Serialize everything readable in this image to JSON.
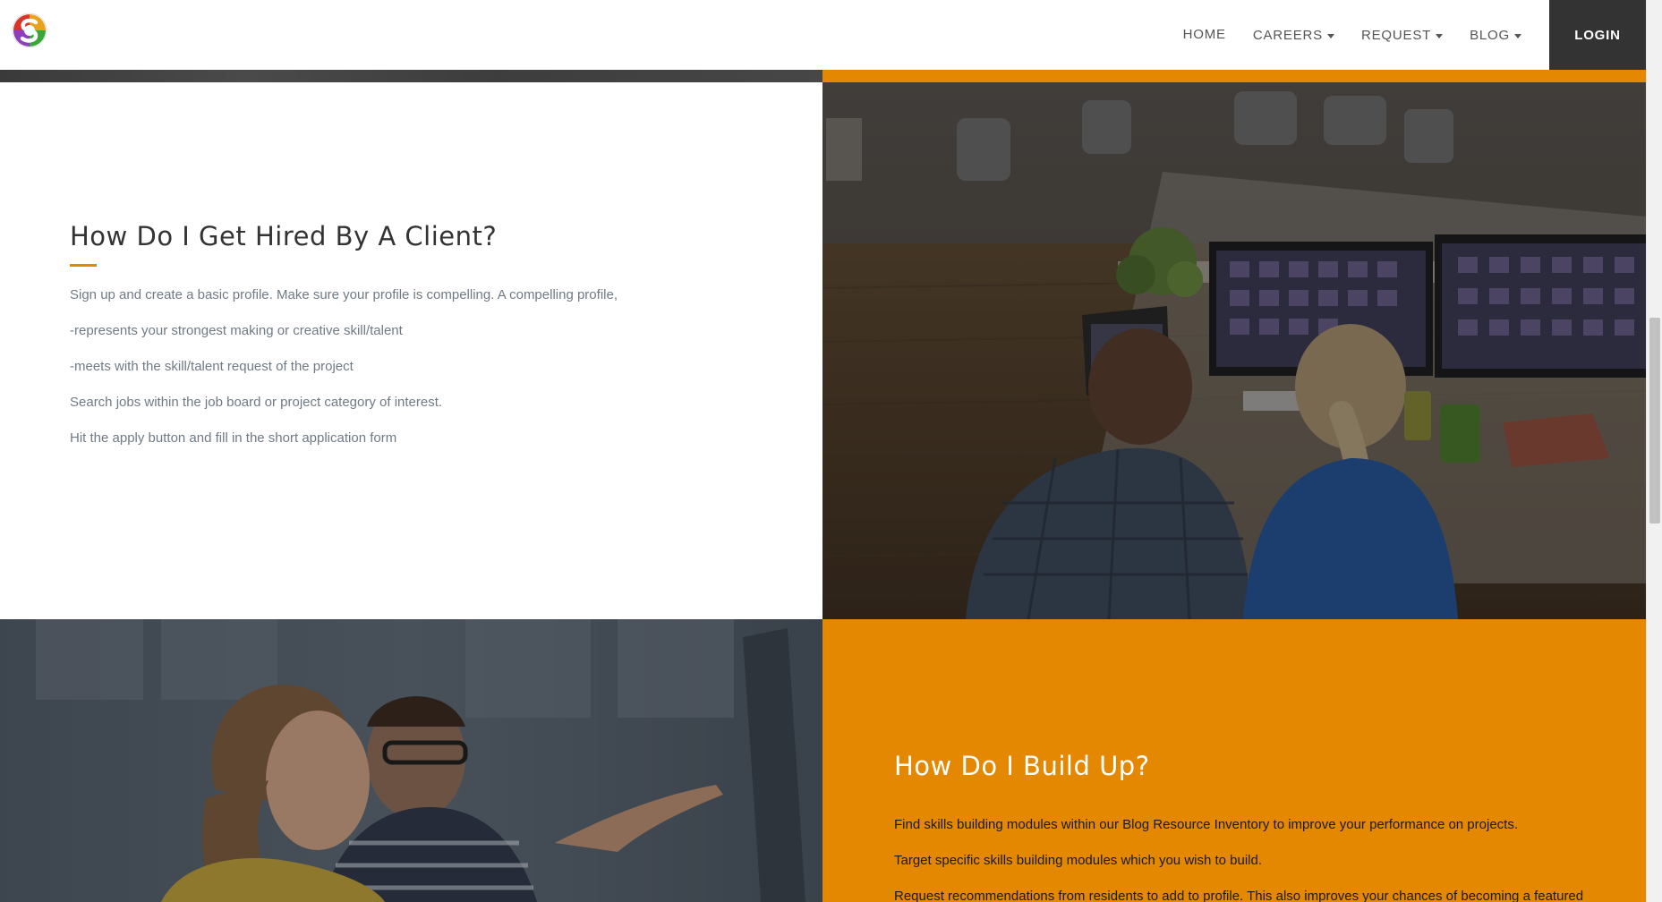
{
  "header": {
    "logo_icon": "site-logo-icon",
    "nav": {
      "home": "HOME",
      "careers": "CAREERS",
      "request": "REQUEST",
      "blog": "BLOG",
      "login": "LOGIN"
    }
  },
  "colors": {
    "accent": "#e38800",
    "login_bg": "#333333",
    "heading_dark": "#333333",
    "body_text": "#707a85"
  },
  "section_hired": {
    "heading": "How Do I Get Hired By A Client?",
    "paragraphs": [
      "Sign up and create a basic profile. Make sure your profile is compelling. A compelling profile,",
      "-represents your strongest making or creative skill/talent",
      "-meets with the skill/talent request of the project",
      "Search jobs within the job board or project category of interest.",
      "Hit the apply button and fill in the short application form"
    ]
  },
  "section_buildup": {
    "heading": "How Do I Build Up?",
    "paragraphs": [
      "Find skills building modules within our Blog Resource Inventory to improve your performance on projects.",
      "Target specific skills building modules which you wish to build.",
      "Request recommendations from residents to add to profile. This also improves your chances of becoming a featured"
    ]
  }
}
